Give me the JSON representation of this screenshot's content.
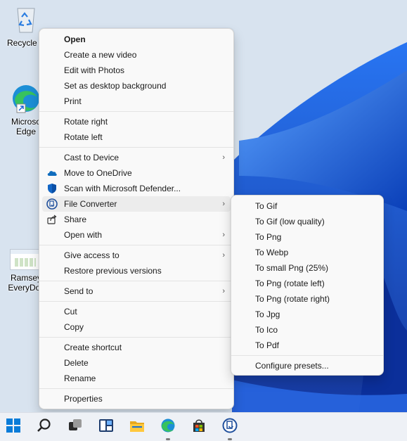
{
  "desktop": {
    "icons": [
      {
        "label": "Recycle B",
        "icon": "recycle-bin-icon"
      },
      {
        "label": "Microso\nEdge",
        "icon": "edge-icon"
      },
      {
        "label": "Ramsey\nEveryDoll",
        "icon": "spreadsheet-file-icon"
      }
    ]
  },
  "context_menu": {
    "groups": [
      [
        {
          "label": "Open",
          "bold": true
        },
        {
          "label": "Create a new video"
        },
        {
          "label": "Edit with Photos"
        },
        {
          "label": "Set as desktop background"
        },
        {
          "label": "Print"
        }
      ],
      [
        {
          "label": "Rotate right"
        },
        {
          "label": "Rotate left"
        }
      ],
      [
        {
          "label": "Cast to Device",
          "submenu": true
        },
        {
          "label": "Move to OneDrive",
          "icon": "onedrive-cloud-icon"
        },
        {
          "label": "Scan with Microsoft Defender...",
          "icon": "defender-shield-icon"
        },
        {
          "label": "File Converter",
          "icon": "file-converter-icon",
          "submenu": true,
          "highlighted": true
        },
        {
          "label": "Share",
          "icon": "share-icon"
        },
        {
          "label": "Open with",
          "submenu": true
        }
      ],
      [
        {
          "label": "Give access to",
          "submenu": true
        },
        {
          "label": "Restore previous versions"
        }
      ],
      [
        {
          "label": "Send to",
          "submenu": true
        }
      ],
      [
        {
          "label": "Cut"
        },
        {
          "label": "Copy"
        }
      ],
      [
        {
          "label": "Create shortcut"
        },
        {
          "label": "Delete"
        },
        {
          "label": "Rename"
        }
      ],
      [
        {
          "label": "Properties"
        }
      ]
    ]
  },
  "file_converter_submenu": {
    "items": [
      "To Gif",
      "To Gif (low quality)",
      "To Png",
      "To Webp",
      "To small Png (25%)",
      "To Png (rotate left)",
      "To Png (rotate right)",
      "To Jpg",
      "To Ico",
      "To Pdf"
    ],
    "footer": "Configure presets..."
  },
  "taskbar": {
    "buttons": [
      {
        "icon": "windows-start-icon",
        "running": false
      },
      {
        "icon": "search-icon",
        "running": false
      },
      {
        "icon": "task-view-icon",
        "running": false
      },
      {
        "icon": "widgets-icon",
        "running": false
      },
      {
        "icon": "file-explorer-icon",
        "running": false
      },
      {
        "icon": "edge-icon",
        "running": true
      },
      {
        "icon": "microsoft-store-icon",
        "running": false
      },
      {
        "icon": "file-converter-icon",
        "running": true
      }
    ]
  },
  "chevron_glyph": "›"
}
